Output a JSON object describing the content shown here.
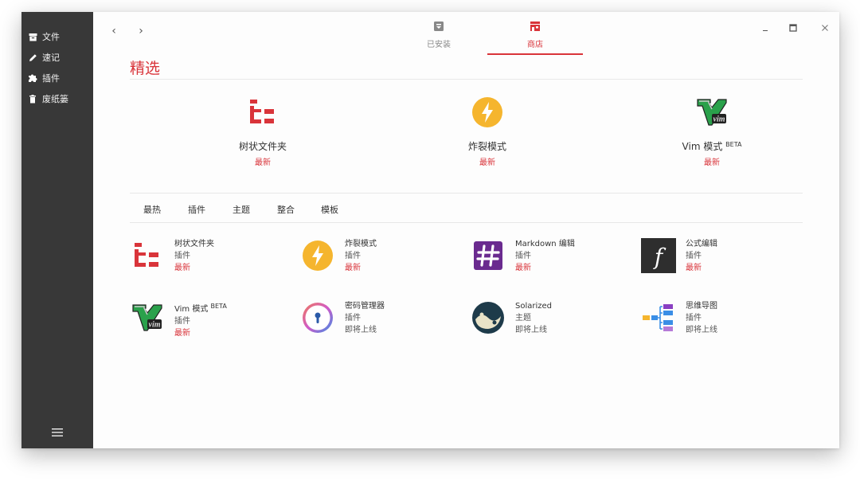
{
  "sidebar": {
    "items": [
      {
        "label": "文件",
        "icon": "archive-icon"
      },
      {
        "label": "速记",
        "icon": "pencil-icon"
      },
      {
        "label": "插件",
        "icon": "puzzle-icon"
      },
      {
        "label": "废纸篓",
        "icon": "trash-icon"
      }
    ],
    "menu_icon": "hamburger-menu-icon"
  },
  "topbar": {
    "back_glyph": "‹",
    "forward_glyph": "›",
    "tabs": [
      {
        "label": "已安装",
        "icon": "installed-box-icon",
        "active": false
      },
      {
        "label": "商店",
        "icon": "store-icon",
        "active": true
      }
    ]
  },
  "featured": {
    "title": "精选",
    "items": [
      {
        "name": "树状文件夹",
        "tag": "最新",
        "icon": "tree-folder-icon"
      },
      {
        "name": "炸裂模式",
        "tag": "最新",
        "icon": "lightning-icon"
      },
      {
        "name": "Vim 模式",
        "beta": "BETA",
        "tag": "最新",
        "icon": "vim-logo-icon"
      }
    ]
  },
  "categories": [
    "最热",
    "插件",
    "主题",
    "整合",
    "模板"
  ],
  "grid": [
    {
      "name": "树状文件夹",
      "type": "插件",
      "status": "最新",
      "status_new": true,
      "icon": "tree-folder-icon"
    },
    {
      "name": "炸裂模式",
      "type": "插件",
      "status": "最新",
      "status_new": true,
      "icon": "lightning-icon"
    },
    {
      "name": "Markdown 编辑",
      "type": "插件",
      "status": "最新",
      "status_new": true,
      "icon": "hash-icon"
    },
    {
      "name": "公式编辑",
      "type": "插件",
      "status": "最新",
      "status_new": true,
      "icon": "function-icon"
    },
    {
      "name": "Vim 模式",
      "beta": "BETA",
      "type": "插件",
      "status": "最新",
      "status_new": true,
      "icon": "vim-logo-icon"
    },
    {
      "name": "密码管理器",
      "type": "插件",
      "status": "即将上线",
      "status_new": false,
      "icon": "keyhole-icon"
    },
    {
      "name": "Solarized",
      "type": "主题",
      "status": "即将上线",
      "status_new": false,
      "icon": "yin-yang-icon"
    },
    {
      "name": "思维导图",
      "type": "插件",
      "status": "即将上线",
      "status_new": false,
      "icon": "mind-map-icon"
    }
  ],
  "colors": {
    "accent": "#d9343a",
    "sidebar_bg": "#383838",
    "lightning": "#f5b52e",
    "markdown": "#6a2a8f",
    "vim_green": "#2aa14b"
  }
}
